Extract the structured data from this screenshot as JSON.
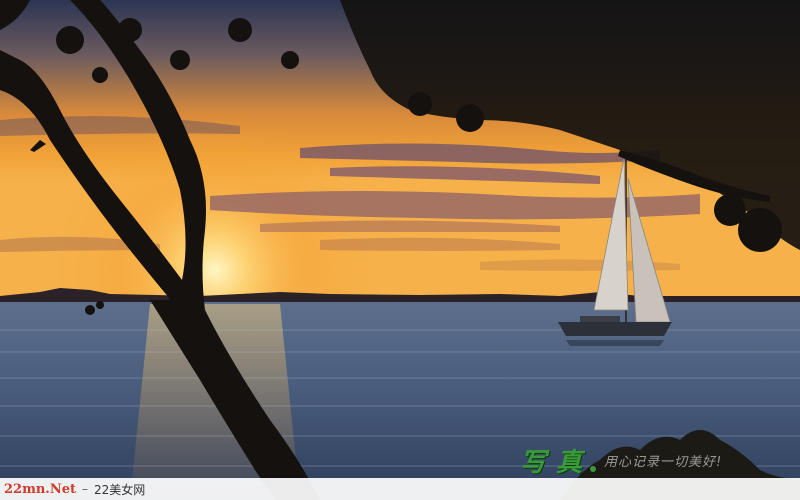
{
  "watermark": {
    "stamp_big": "写真",
    "stamp_small": "用心记录一切美好!",
    "site": "22mn.Net",
    "separator": "–",
    "site_name": "22美女网",
    "stamp_color": "#3a9a3a",
    "site_color": "#d23a2a"
  },
  "scene": {
    "subject": "sunset-over-lake-with-sailboat",
    "colors": {
      "sky_top": "#2c3554",
      "sky_glow": "#f5a030",
      "sun": "#fff3b0",
      "water": "#4b5e7e",
      "silhouette": "#14110f"
    }
  }
}
